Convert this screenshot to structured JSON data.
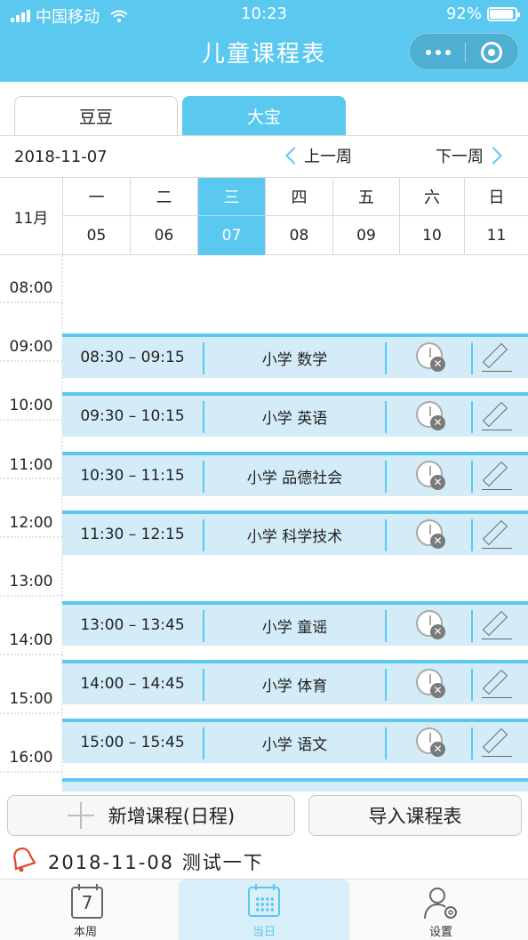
{
  "status_bar": {
    "carrier": "中国移动",
    "time": "10:23",
    "battery": "92%",
    "battery_level": 0.92
  },
  "header": {
    "title": "儿童课程表",
    "accent_color": "#5bc8ef"
  },
  "tabs": [
    {
      "label": "豆豆",
      "active": false
    },
    {
      "label": "大宝",
      "active": true
    }
  ],
  "week_nav": {
    "date": "2018-11-07",
    "prev_label": "上一周",
    "next_label": "下一周"
  },
  "calendar": {
    "month_label": "11月",
    "days": [
      {
        "weekday": "一",
        "date": "05"
      },
      {
        "weekday": "二",
        "date": "06"
      },
      {
        "weekday": "三",
        "date": "07",
        "active": true
      },
      {
        "weekday": "四",
        "date": "08"
      },
      {
        "weekday": "五",
        "date": "09"
      },
      {
        "weekday": "六",
        "date": "10"
      },
      {
        "weekday": "日",
        "date": "11"
      }
    ]
  },
  "timeline": {
    "hours": [
      "08:00",
      "09:00",
      "10:00",
      "11:00",
      "12:00",
      "13:00",
      "14:00",
      "15:00",
      "16:00"
    ],
    "courses": [
      {
        "time": "08:30 – 09:15",
        "name": "小学 数学"
      },
      {
        "time": "09:30 – 10:15",
        "name": "小学 英语"
      },
      {
        "time": "10:30 – 11:15",
        "name": "小学 品德社会"
      },
      {
        "time": "11:30 – 12:15",
        "name": "小学 科学技术"
      },
      {
        "time": "13:00 – 13:45",
        "name": "小学 童谣"
      },
      {
        "time": "14:00 – 14:45",
        "name": "小学 体育"
      },
      {
        "time": "15:00 – 15:45",
        "name": "小学 语文"
      }
    ]
  },
  "actions": {
    "add_label": "新增课程(日程)",
    "import_label": "导入课程表"
  },
  "reminder": {
    "text": "2018-11-08 测试一下"
  },
  "tabbar": {
    "week_label": "本周",
    "week_icon_text": "7",
    "today_label": "当日",
    "settings_label": "设置"
  }
}
